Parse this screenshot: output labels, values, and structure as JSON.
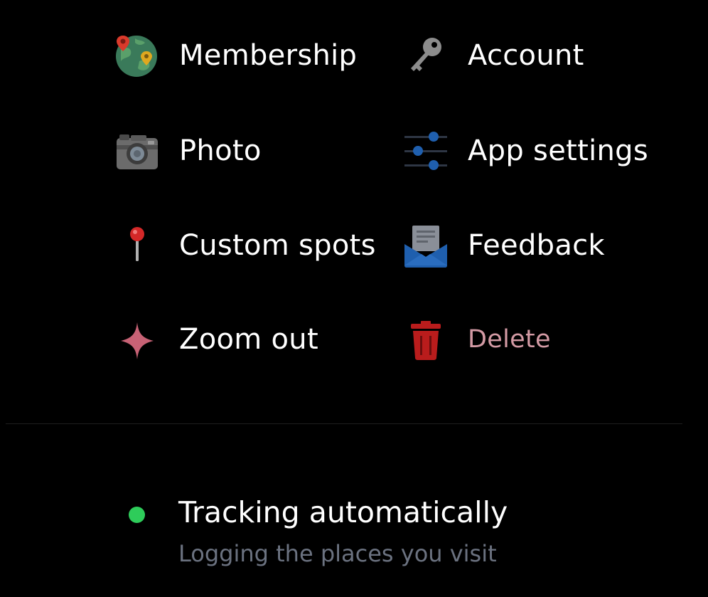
{
  "menu": {
    "items": [
      {
        "label": "Membership",
        "icon": "globe-icon"
      },
      {
        "label": "Account",
        "icon": "key-icon"
      },
      {
        "label": "Photo",
        "icon": "camera-icon"
      },
      {
        "label": "App settings",
        "icon": "sliders-icon"
      },
      {
        "label": "Custom spots",
        "icon": "pushpin-icon"
      },
      {
        "label": "Feedback",
        "icon": "envelope-icon"
      },
      {
        "label": "Zoom out",
        "icon": "sparkle-icon"
      },
      {
        "label": "Delete",
        "icon": "trash-icon"
      }
    ]
  },
  "status": {
    "title": "Tracking automatically",
    "subtitle": "Logging the places you visit",
    "indicator_color": "#2ecc5a"
  },
  "colors": {
    "background": "#000000",
    "danger_text": "#d39aa4",
    "danger_icon": "#b91c1c",
    "muted_text": "#6b7280"
  }
}
